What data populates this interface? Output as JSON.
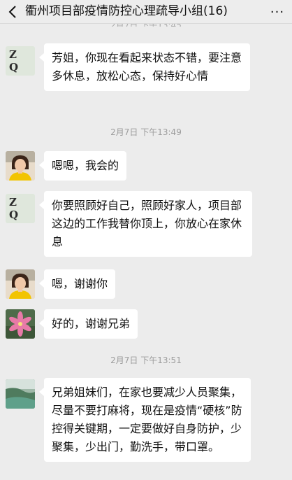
{
  "header": {
    "back_icon": "chevron-left-icon",
    "title": "衢州项目部疫情防控心理疏导小组(16)",
    "more_label": "···"
  },
  "top_time_cut": "2月7日 下午13:45",
  "messages": [
    {
      "avatar": "zq",
      "avatar_text": "Z Q",
      "text": "芳姐，你现在看起来状态不错，要注意多休息，放松心态，保持好心情"
    },
    {
      "avatar": "woman",
      "text": "嗯嗯，我会的"
    },
    {
      "avatar": "zq",
      "avatar_text": "Z Q",
      "text": "你要照顾好自己，照顾好家人，项目部这边的工作我替你顶上，你放心在家休息"
    },
    {
      "avatar": "woman",
      "text": "嗯，谢谢你"
    },
    {
      "avatar": "flower",
      "text": "好的，谢谢兄弟"
    },
    {
      "avatar": "scenery",
      "text": "兄弟姐妹们，在家也要减少人员聚集，尽量不要打麻将，现在是疫情“硬核”防控得关键期，一定要做好自身防护，少聚集，少出门，勤洗手，带口罩。"
    }
  ],
  "timestamps": [
    "2月7日 下午13:49",
    "2月7日 下午13:51"
  ],
  "colors": {
    "chat_background": "#ececec",
    "bubble": "#ffffff",
    "timestamp": "#9c9c9c"
  }
}
